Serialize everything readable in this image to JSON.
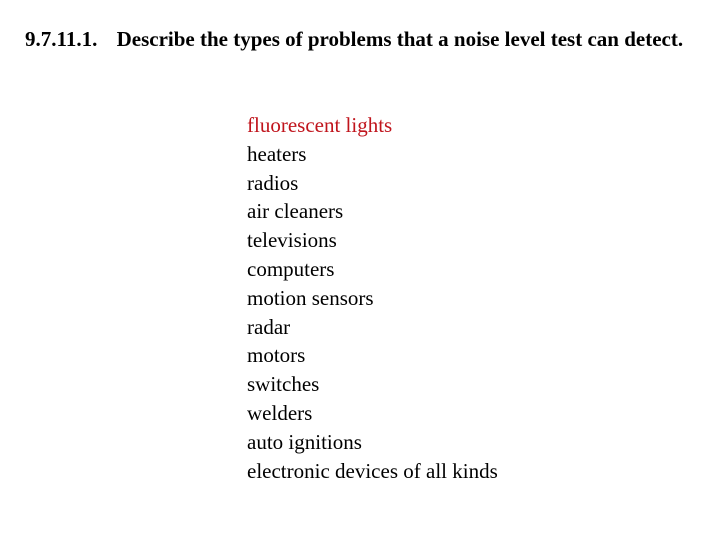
{
  "question": {
    "number": "9.7.11.1.",
    "text": "Describe the types of problems that a noise level test can detect."
  },
  "answer_items": [
    {
      "label": "fluorescent lights",
      "highlighted": true
    },
    {
      "label": "heaters",
      "highlighted": false
    },
    {
      "label": "radios",
      "highlighted": false
    },
    {
      "label": "air cleaners",
      "highlighted": false
    },
    {
      "label": "televisions",
      "highlighted": false
    },
    {
      "label": "computers",
      "highlighted": false
    },
    {
      "label": "motion sensors",
      "highlighted": false
    },
    {
      "label": "radar",
      "highlighted": false
    },
    {
      "label": "motors",
      "highlighted": false
    },
    {
      "label": "switches",
      "highlighted": false
    },
    {
      "label": "welders",
      "highlighted": false
    },
    {
      "label": "auto ignitions",
      "highlighted": false
    },
    {
      "label": "electronic devices of all kinds",
      "highlighted": false
    }
  ],
  "colors": {
    "highlight": "#c0141c",
    "text": "#000000",
    "background": "#ffffff"
  }
}
